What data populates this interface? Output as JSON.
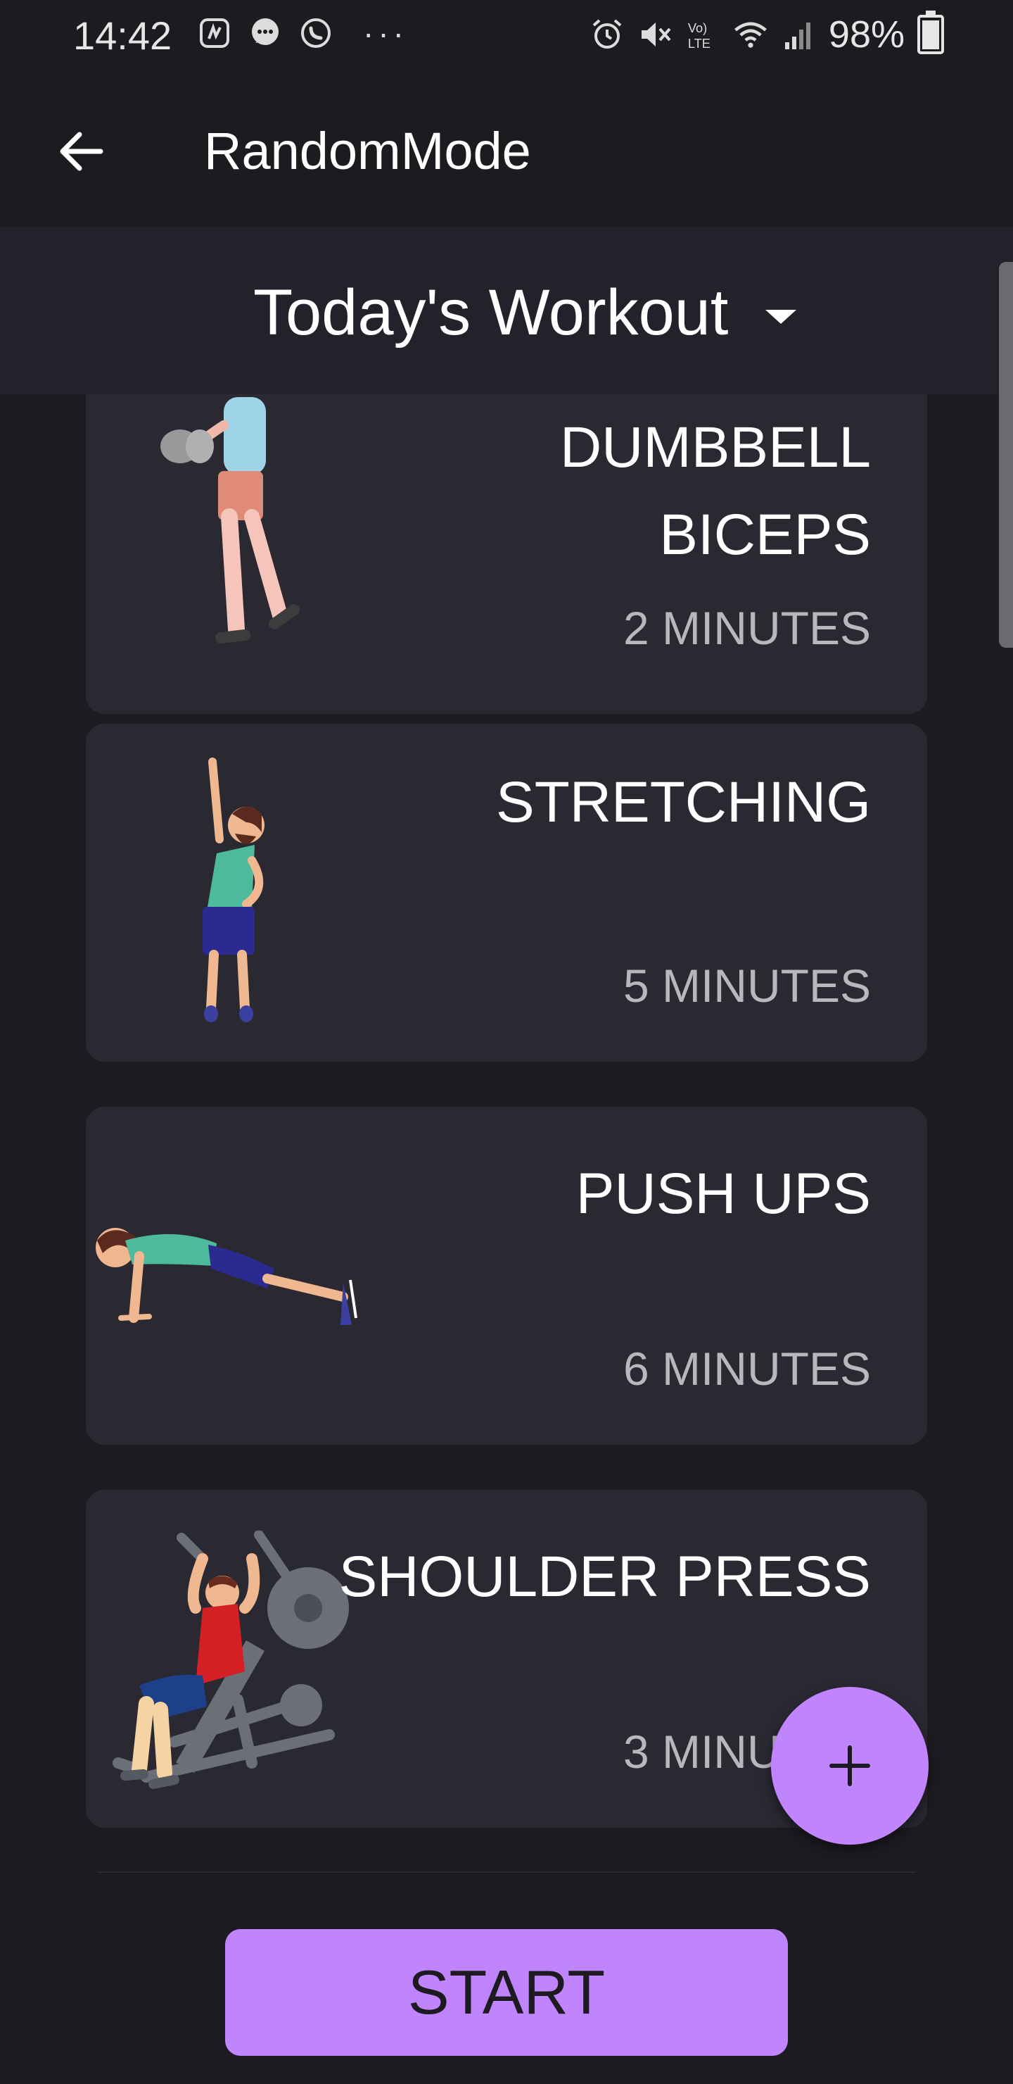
{
  "status_bar": {
    "time": "14:42",
    "battery": "98%",
    "left_icons": [
      "saavn-icon",
      "message-icon",
      "whatsapp-icon"
    ],
    "right_icons": [
      "alarm-icon",
      "mute-icon",
      "volte-icon",
      "wifi-icon",
      "signal-icon",
      "battery-icon"
    ]
  },
  "app_bar": {
    "title": "RandomMode"
  },
  "workout_selector": {
    "selected": "Today's Workout"
  },
  "exercises": [
    {
      "name": "DUMBBELL BICEPS",
      "duration": "2 MINUTES",
      "icon": "dumbbell-biceps-figure"
    },
    {
      "name": "STRETCHING",
      "duration": "5 MINUTES",
      "icon": "stretching-figure"
    },
    {
      "name": "PUSH UPS",
      "duration": "6 MINUTES",
      "icon": "push-ups-figure"
    },
    {
      "name": "SHOULDER PRESS",
      "duration": "3 MINUTES",
      "icon": "shoulder-press-figure"
    }
  ],
  "fab": {
    "icon": "plus-icon"
  },
  "start_button": {
    "label": "START"
  },
  "colors": {
    "background": "#1d1b21",
    "card": "#2a2831",
    "accent": "#c084fc",
    "duration_text": "#b9b7bd"
  }
}
